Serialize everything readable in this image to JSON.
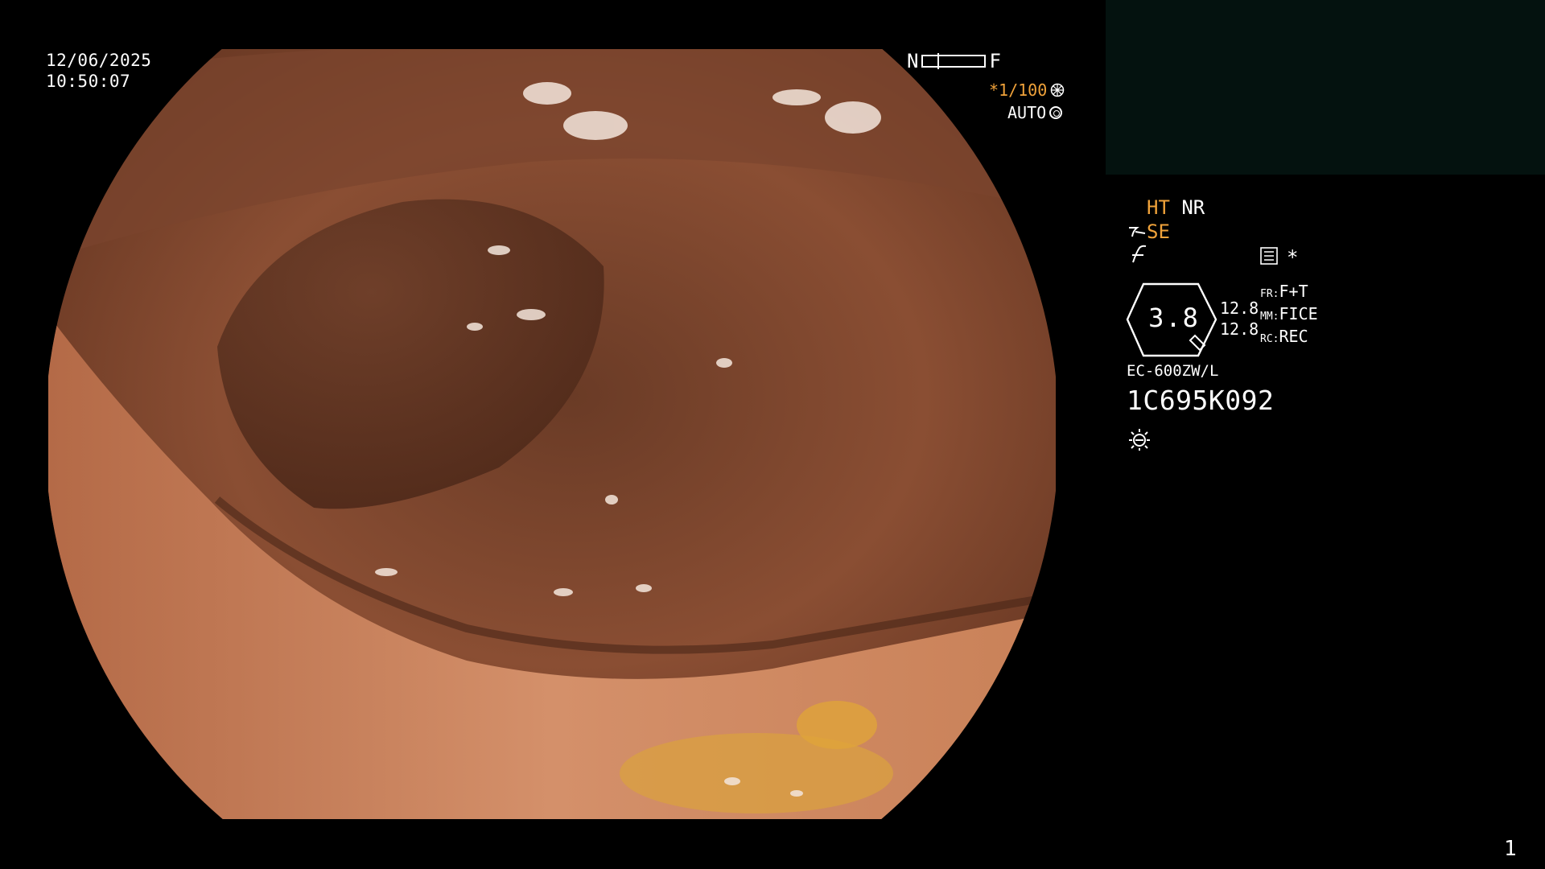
{
  "overlay": {
    "date": "12/06/2025",
    "time": "10:50:07",
    "focus_near": "N",
    "focus_far": "F",
    "shutter": "*1/100",
    "shutter_icon": "aperture-icon",
    "iris_mode": "AUTO",
    "iris_icon": "iris-icon",
    "page_number": "1"
  },
  "status": {
    "ht": "HT",
    "nr": "NR",
    "se": "SE",
    "star": "*",
    "zoom_value": "3.8",
    "values": [
      "12.8",
      "12.8"
    ],
    "labels": [
      {
        "key": "FR:",
        "value": "F+T"
      },
      {
        "key": "MM:",
        "value": "FICE"
      },
      {
        "key": "RC:",
        "value": "REC"
      }
    ],
    "model": "EC-600ZW/L",
    "serial": "1C695K092",
    "icons": [
      "scope-angle-icon",
      "freeze-curve-icon",
      "menu-list-icon",
      "light-sun-icon"
    ]
  },
  "colors": {
    "accent": "#f0a23a",
    "panel": "#04120f",
    "background": "#000000"
  }
}
